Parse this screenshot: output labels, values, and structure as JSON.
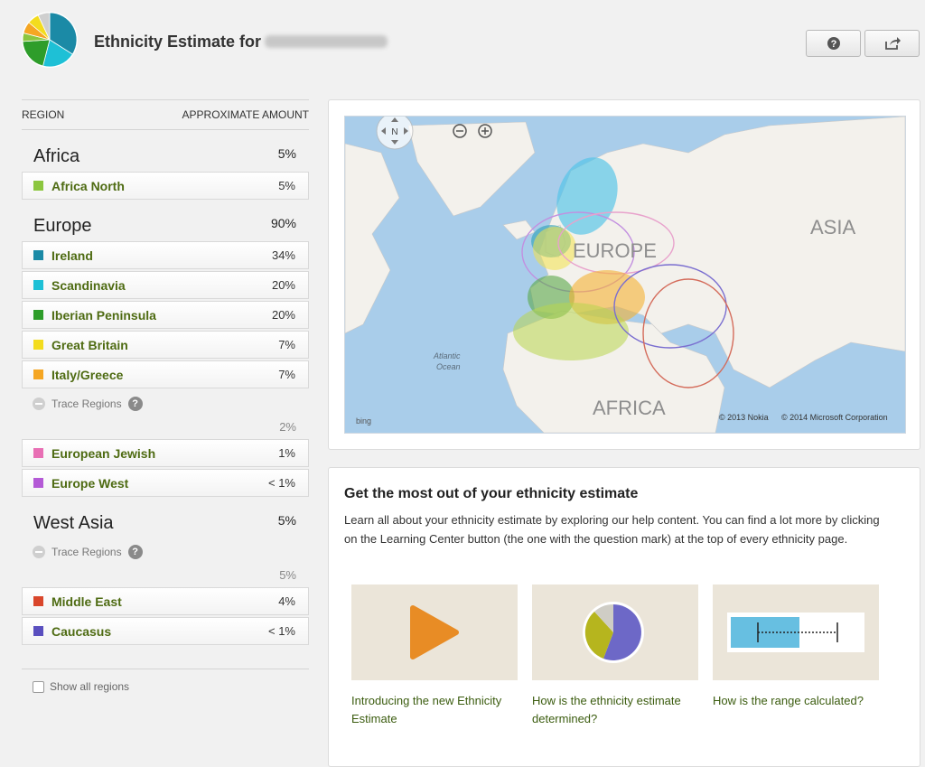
{
  "header": {
    "title": "Ethnicity Estimate for",
    "help_icon": "question-circle-icon",
    "share_icon": "share-icon"
  },
  "table": {
    "col_region": "REGION",
    "col_amount": "APPROXIMATE AMOUNT"
  },
  "regions": {
    "africa": {
      "name": "Africa",
      "pct": "5%",
      "items": [
        {
          "label": "Africa North",
          "pct": "5%",
          "color": "#8cc63f"
        }
      ]
    },
    "europe": {
      "name": "Europe",
      "pct": "90%",
      "items": [
        {
          "label": "Ireland",
          "pct": "34%",
          "color": "#1b8aa6"
        },
        {
          "label": "Scandinavia",
          "pct": "20%",
          "color": "#1ec0d6"
        },
        {
          "label": "Iberian Peninsula",
          "pct": "20%",
          "color": "#2e9d2a"
        },
        {
          "label": "Great Britain",
          "pct": "7%",
          "color": "#f3dc1e"
        },
        {
          "label": "Italy/Greece",
          "pct": "7%",
          "color": "#f5a623"
        }
      ],
      "trace_label": "Trace Regions",
      "trace_pct": "2%",
      "trace_items": [
        {
          "label": "European Jewish",
          "pct": "1%",
          "color": "#e86fb4"
        },
        {
          "label": "Europe West",
          "pct": "< 1%",
          "color": "#b45ad6"
        }
      ]
    },
    "west_asia": {
      "name": "West Asia",
      "pct": "5%",
      "trace_label": "Trace Regions",
      "trace_pct": "5%",
      "trace_items": [
        {
          "label": "Middle East",
          "pct": "4%",
          "color": "#d9462b"
        },
        {
          "label": "Caucasus",
          "pct": "< 1%",
          "color": "#5a4fbf"
        }
      ]
    }
  },
  "show_all_label": "Show all regions",
  "map": {
    "compass_label": "N",
    "labels": {
      "europe": "EUROPE",
      "asia": "ASIA",
      "africa": "AFRICA",
      "atlantic_1": "Atlantic",
      "atlantic_2": "Ocean"
    },
    "attribution_bing": "bing",
    "attribution_nokia": "© 2013 Nokia",
    "attribution_ms": "© 2014 Microsoft Corporation",
    "colors": {
      "water": "#a9cdea",
      "land": "#f3f1ec"
    }
  },
  "info": {
    "title": "Get the most out of your ethnicity estimate",
    "text": "Learn all about your ethnicity estimate by exploring our help content. You can find a lot more by clicking on the Learning Center button (the one with the question mark) at the top of every ethnicity page.",
    "tiles": [
      {
        "caption": "Introducing the new Ethnicity Estimate",
        "icon": "play-icon"
      },
      {
        "caption": "How is the ethnicity estimate determined?",
        "icon": "pie-chart-icon"
      },
      {
        "caption": "How is the range calculated?",
        "icon": "range-bar-icon"
      }
    ]
  }
}
